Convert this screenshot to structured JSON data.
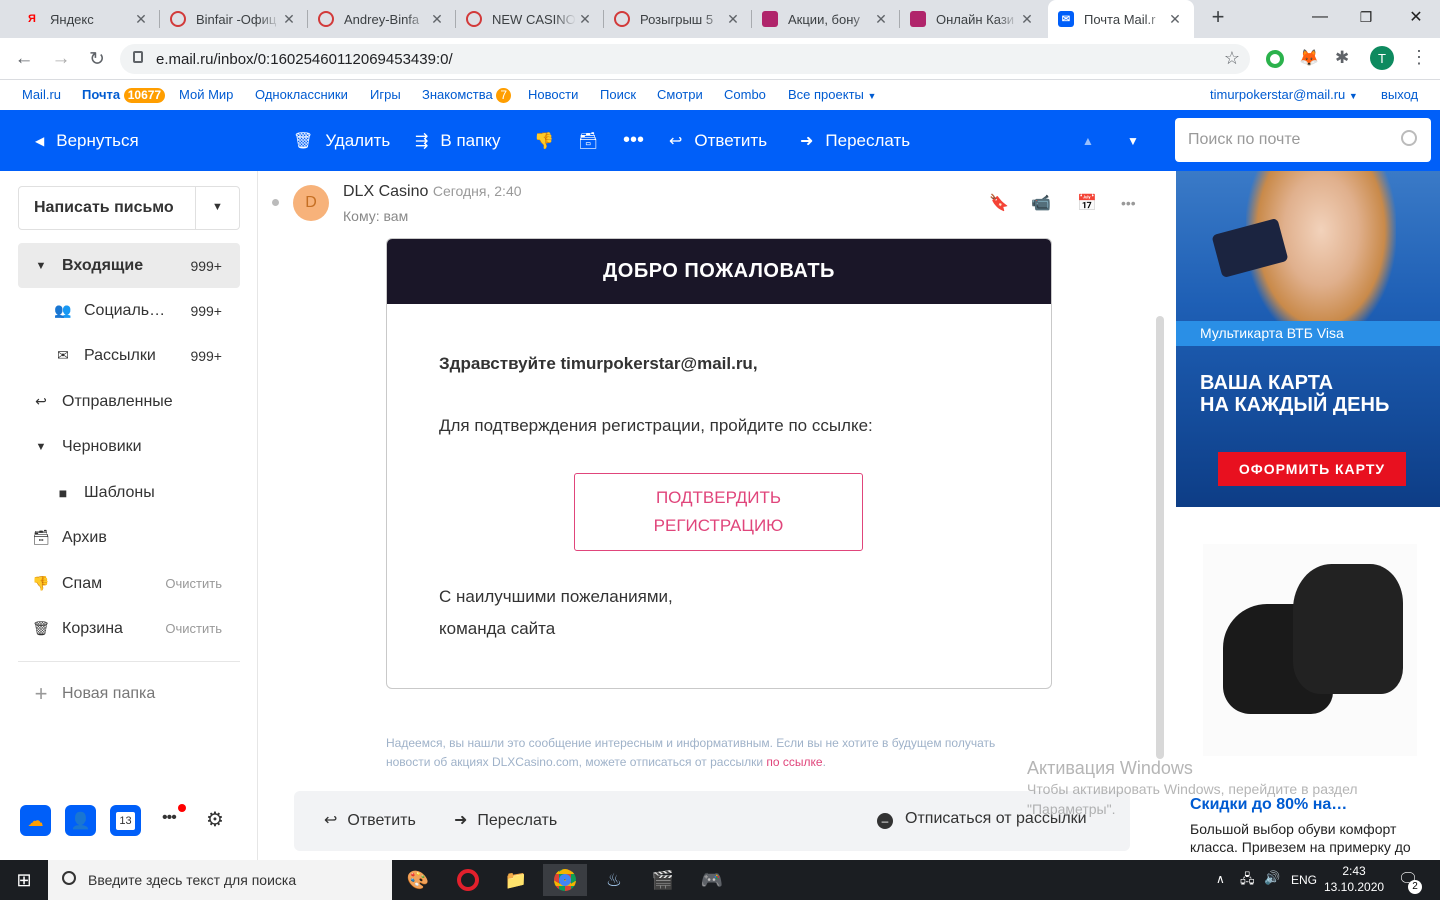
{
  "tabs": [
    {
      "title": "Яндекс",
      "fav": "Я",
      "favcolor": "#ff0000"
    },
    {
      "title": "Binfair -Офиц",
      "fav": "✺",
      "favcolor": "#d23a3a"
    },
    {
      "title": "Andrey-Binfa",
      "fav": "✺",
      "favcolor": "#d23a3a"
    },
    {
      "title": "NEW CASINO",
      "fav": "✺",
      "favcolor": "#d23a3a"
    },
    {
      "title": "Розыгрыш 5",
      "fav": "✺",
      "favcolor": "#d23a3a"
    },
    {
      "title": "Акции, бону",
      "fav": "◉",
      "favcolor": "#b0256b"
    },
    {
      "title": "Онлайн Кази",
      "fav": "◉",
      "favcolor": "#b0256b"
    },
    {
      "title": "Почта Mail.r",
      "fav": "✉",
      "favcolor": "#005ff9"
    }
  ],
  "browser": {
    "url": "e.mail.ru/inbox/0:16025460112069453439:0/",
    "profile_initial": "T"
  },
  "topnav": {
    "items": [
      "Mail.ru",
      "Почта",
      "Мой Мир",
      "Одноклассники",
      "Игры",
      "Знакомства",
      "Новости",
      "Поиск",
      "Смотри",
      "Combo",
      "Все проекты"
    ],
    "mail_badge": "10677",
    "dating_badge": "7",
    "user": "timurpokerstar@mail.ru",
    "logout": "выход"
  },
  "toolbar": {
    "back": "Вернуться",
    "delete": "Удалить",
    "to_folder": "В папку",
    "reply": "Ответить",
    "forward": "Переслать",
    "search_placeholder": "Поиск по почте"
  },
  "sidebar": {
    "compose": "Написать письмо",
    "folders": [
      {
        "label": "Входящие",
        "count": "999+"
      },
      {
        "label": "Социаль…",
        "count": "999+"
      },
      {
        "label": "Рассылки",
        "count": "999+"
      },
      {
        "label": "Отправленные"
      },
      {
        "label": "Черновики"
      },
      {
        "label": "Шаблоны"
      },
      {
        "label": "Архив"
      },
      {
        "label": "Спам",
        "action": "Очистить"
      },
      {
        "label": "Корзина",
        "action": "Очистить"
      }
    ],
    "new_folder": "Новая папка",
    "calendar_day": "13"
  },
  "message": {
    "avatar": "D",
    "sender": "DLX Casino",
    "date": "Сегодня, 2:40",
    "to": "Кому: вам",
    "header": "ДОБРО ПОЖАЛОВАТЬ",
    "greeting": "Здравствуйте timurpokerstar@mail.ru,",
    "body": "Для подтверждения регистрации, пройдите по ссылке:",
    "cta_line1": "ПОДТВЕРДИТЬ",
    "cta_line2": "РЕГИСТРАЦИЮ",
    "sign1": "С наилучшими пожеланиями,",
    "sign2": "команда сайта",
    "footer": "Надеемся, вы нашли это сообщение интересным и информативным. Если вы не хотите в будущем получать новости об акциях DLXCasino.com, можете отписаться от рассылки",
    "footer_link": "по ссылке",
    "footer_end": "."
  },
  "bottom_actions": {
    "reply": "Ответить",
    "forward": "Переслать",
    "unsubscribe": "Отписаться от рассылки"
  },
  "ads": {
    "card_label": "Мультикарта ВТБ Visa",
    "card_line1": "ВАША КАРТА",
    "card_line2": "НА КАЖДЫЙ ДЕНЬ",
    "card_button": "ОФОРМИТЬ КАРТУ",
    "shoe_title": "Скидки до 80% на…",
    "shoe_text1": "Большой выбор обуви комфорт",
    "shoe_text2": "класса. Привезем на примерку до"
  },
  "watermark": {
    "line1": "Активация Windows",
    "line2": "Чтобы активировать Windows, перейдите в раздел",
    "line3": "\"Параметры\"."
  },
  "taskbar": {
    "search_placeholder": "Введите здесь текст для поиска",
    "lang": "ENG",
    "time": "2:43",
    "date": "13.10.2020",
    "notif_count": "2"
  }
}
